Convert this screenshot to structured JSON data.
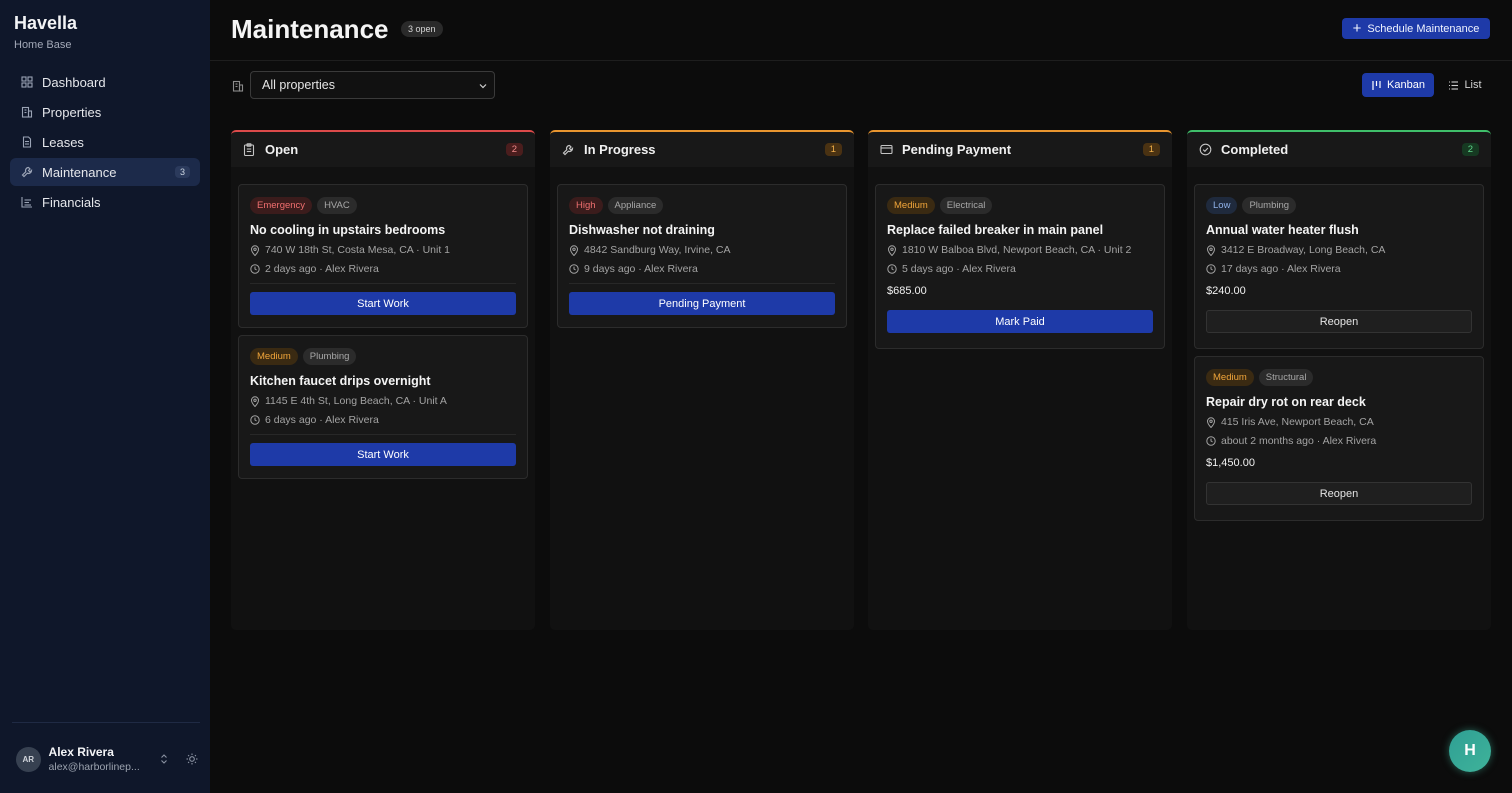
{
  "sidebar": {
    "brand": "Havella",
    "subtitle": "Home Base",
    "nav": [
      {
        "label": "Dashboard"
      },
      {
        "label": "Properties"
      },
      {
        "label": "Leases"
      },
      {
        "label": "Maintenance",
        "badge": "3"
      },
      {
        "label": "Financials"
      }
    ],
    "user": {
      "initials": "AR",
      "name": "Alex Rivera",
      "email": "alex@harborlinep..."
    }
  },
  "header": {
    "title": "Maintenance",
    "open_badge": "3 open",
    "schedule_button": "Schedule Maintenance"
  },
  "filters": {
    "property_select": "All properties",
    "view_kanban": "Kanban",
    "view_list": "List"
  },
  "columns": [
    {
      "title": "Open",
      "count": "2",
      "cards": [
        {
          "priority": "Emergency",
          "category": "HVAC",
          "title": "No cooling in upstairs bedrooms",
          "address": "740 W 18th St, Costa Mesa, CA · Unit 1",
          "time": "2 days ago · Alex Rivera",
          "button": "Start Work"
        },
        {
          "priority": "Medium",
          "category": "Plumbing",
          "title": "Kitchen faucet drips overnight",
          "address": "1145 E 4th St, Long Beach, CA · Unit A",
          "time": "6 days ago · Alex Rivera",
          "button": "Start Work"
        }
      ]
    },
    {
      "title": "In Progress",
      "count": "1",
      "cards": [
        {
          "priority": "High",
          "category": "Appliance",
          "title": "Dishwasher not draining",
          "address": "4842 Sandburg Way, Irvine, CA",
          "time": "9 days ago · Alex Rivera",
          "button": "Pending Payment"
        }
      ]
    },
    {
      "title": "Pending Payment",
      "count": "1",
      "cards": [
        {
          "priority": "Medium",
          "category": "Electrical",
          "title": "Replace failed breaker in main panel",
          "address": "1810 W Balboa Blvd, Newport Beach, CA · Unit 2",
          "time": "5 days ago · Alex Rivera",
          "price": "$685.00",
          "button": "Mark Paid"
        }
      ]
    },
    {
      "title": "Completed",
      "count": "2",
      "cards": [
        {
          "priority": "Low",
          "category": "Plumbing",
          "title": "Annual water heater flush",
          "address": "3412 E Broadway, Long Beach, CA",
          "time": "17 days ago · Alex Rivera",
          "price": "$240.00",
          "button": "Reopen"
        },
        {
          "priority": "Medium",
          "category": "Structural",
          "title": "Repair dry rot on rear deck",
          "address": "415 Iris Ave, Newport Beach, CA",
          "time": "about 2 months ago · Alex Rivera",
          "price": "$1,450.00",
          "button": "Reopen"
        }
      ]
    }
  ],
  "assistant": {
    "label": "H"
  },
  "colors": {
    "accent": "#1e3aa8",
    "open": "#dc4a4a",
    "in_progress": "#e8952f",
    "pending_payment": "#e8952f",
    "completed": "#3fbf6a"
  }
}
